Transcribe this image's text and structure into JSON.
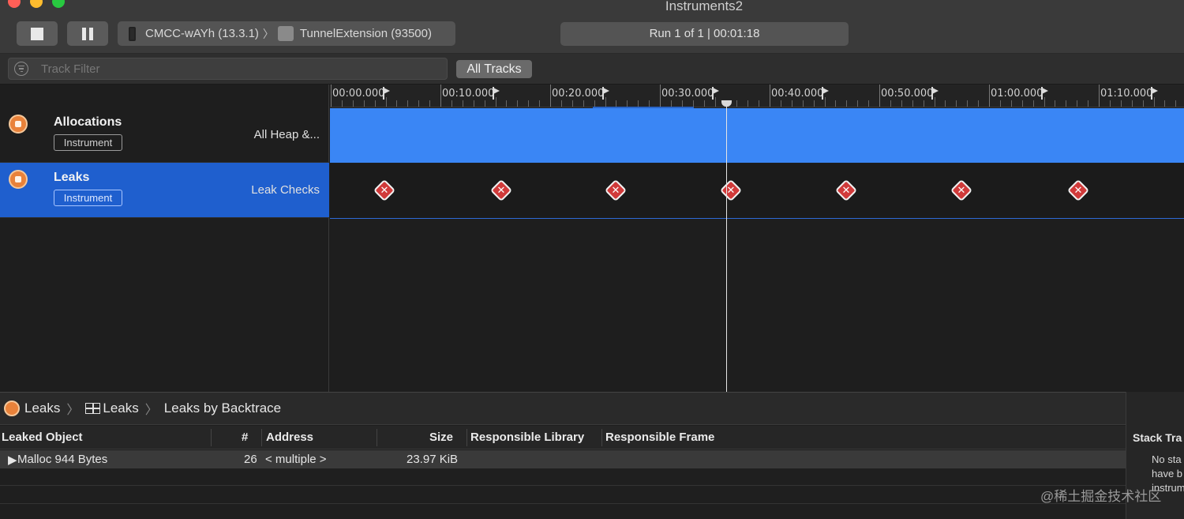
{
  "window": {
    "title": "Instruments2"
  },
  "toolbar": {
    "device": "CMCC-wAYh (13.3.1)",
    "process": "TunnelExtension (93500)",
    "run_status": "Run 1 of 1  |  00:01:18"
  },
  "filter": {
    "placeholder": "Track Filter",
    "all_tracks": "All Tracks"
  },
  "ruler": {
    "labels": [
      "00:00.000",
      "00:10.000",
      "00:20.000",
      "00:30.000",
      "00:40.000",
      "00:50.000",
      "01:00.000",
      "01:10.000"
    ]
  },
  "tracks": [
    {
      "name": "Allocations",
      "badge": "Instrument",
      "detail": "All Heap &...",
      "selected": false,
      "color": "#3a86f5"
    },
    {
      "name": "Leaks",
      "badge": "Instrument",
      "detail": "Leak Checks",
      "selected": true,
      "color": "#1f5fce"
    }
  ],
  "leak_checks": {
    "count": 7,
    "status_color": "#d03a3a"
  },
  "jumpbar": {
    "instrument": "Leaks",
    "view": "Leaks",
    "mode": "Leaks by Backtrace"
  },
  "table": {
    "columns": [
      "Leaked Object",
      "#",
      "Address",
      "Size",
      "Responsible Library",
      "Responsible Frame"
    ],
    "rows": [
      {
        "object": "Malloc 944 Bytes",
        "count": "26",
        "address": "< multiple >",
        "size": "23.97 KiB",
        "library": "",
        "frame": ""
      }
    ]
  },
  "side_panel": {
    "title": "Stack Tra",
    "lines": [
      "No sta",
      "have b",
      "instrum"
    ]
  },
  "watermark": "@稀土掘金技术社区"
}
